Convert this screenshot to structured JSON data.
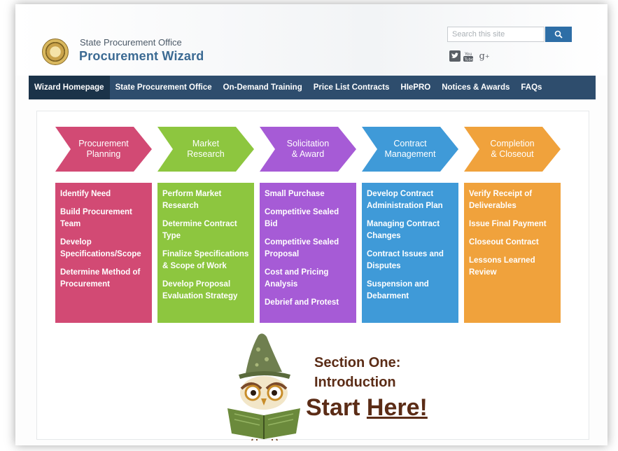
{
  "header": {
    "subtitle": "State Procurement Office",
    "title": "Procurement Wizard",
    "search": {
      "placeholder": "Search this site"
    }
  },
  "nav": {
    "items": [
      {
        "label": "Wizard Homepage",
        "active": true
      },
      {
        "label": "State Procurement Office"
      },
      {
        "label": "On-Demand Training"
      },
      {
        "label": "Price List Contracts"
      },
      {
        "label": "HIePRO"
      },
      {
        "label": "Notices & Awards"
      },
      {
        "label": "FAQs"
      }
    ]
  },
  "phases": [
    {
      "title": [
        "Procurement",
        "Planning"
      ],
      "color": "#d24a74",
      "items": [
        "Identify Need",
        "Build Procurement Team",
        "Develop Specifications/Scope",
        "Determine Method of Procurement"
      ]
    },
    {
      "title": [
        "Market",
        "Research"
      ],
      "color": "#8dc63f",
      "items": [
        "Perform Market Research",
        "Determine Contract Type",
        "Finalize Specifications & Scope of Work",
        "Develop Proposal Evaluation Strategy"
      ]
    },
    {
      "title": [
        "Solicitation",
        "& Award"
      ],
      "color": "#a65bd6",
      "items": [
        "Small Purchase",
        "Competitive Sealed Bid",
        "Competitive Sealed Proposal",
        "Cost and Pricing Analysis",
        "Debrief and Protest"
      ]
    },
    {
      "title": [
        "Contract",
        "Management"
      ],
      "color": "#3f9ad8",
      "items": [
        "Develop Contract Administration Plan",
        "Managing Contract Changes",
        "Contract Issues and Disputes",
        "Suspension and Debarment"
      ]
    },
    {
      "title": [
        "Completion",
        "& Closeout"
      ],
      "color": "#f0a23c",
      "items": [
        "Verify Receipt of Deliverables",
        "Issue Final Payment",
        "Closeout Contract",
        "Lessons Learned Review"
      ]
    }
  ],
  "intro": {
    "line1": "Section One:",
    "line2": "Introduction",
    "start": "Start",
    "here": "Here!"
  }
}
